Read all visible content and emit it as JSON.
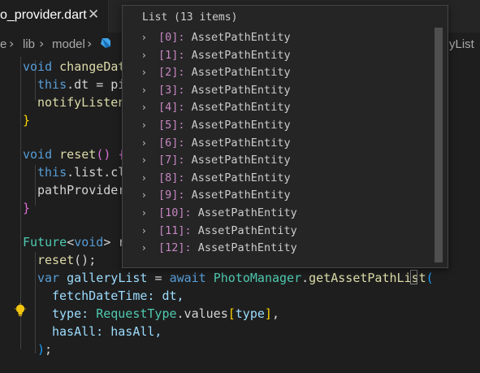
{
  "tab": {
    "title": "o_provider.dart",
    "close": "✕"
  },
  "breadcrumb": {
    "items": [
      "e",
      "lib",
      "model"
    ],
    "separator": "›",
    "trailing": "yList"
  },
  "code": {
    "l1": {
      "kw": "void",
      "fn": "changeDat"
    },
    "l2": {
      "kw": "this",
      "rest": ".dt = pi"
    },
    "l3": {
      "fn": "notifyListen"
    },
    "l4": {
      "brace": "}"
    },
    "l6": {
      "kw": "void",
      "fn": "reset",
      "tail": "() {"
    },
    "l7": {
      "kw": "this",
      "rest": ".list.cl"
    },
    "l8": {
      "rest": "pathProvider"
    },
    "l9": {
      "brace": "}"
    },
    "l11": {
      "ty": "Future",
      "lt": "<",
      "kw": "void",
      "gt": ">",
      "rest": " r"
    },
    "l12": {
      "fn": "reset",
      "tail": "();"
    },
    "l13": {
      "kw": "var",
      "vr": "galleryList",
      "eq": " = ",
      "kw2": "await",
      "ty": "PhotoManager",
      "dot": ".",
      "fn": "getAssetPathList",
      "paren": "("
    },
    "l14": {
      "text": "fetchDateTime: dt,"
    },
    "l15": {
      "label": "type: ",
      "ty": "RequestType",
      "dot": ".values",
      "lb": "[",
      "vr": "type",
      "rb": "]",
      "comma": ","
    },
    "l16": {
      "text": "hasAll: hasAll,"
    },
    "l17": {
      "paren": ")",
      "semi": ";"
    }
  },
  "hover": {
    "title": "List (13 items)",
    "chevron": "›",
    "items": [
      {
        "index": "[0]:",
        "value": "AssetPathEntity"
      },
      {
        "index": "[1]:",
        "value": "AssetPathEntity"
      },
      {
        "index": "[2]:",
        "value": "AssetPathEntity"
      },
      {
        "index": "[3]:",
        "value": "AssetPathEntity"
      },
      {
        "index": "[4]:",
        "value": "AssetPathEntity"
      },
      {
        "index": "[5]:",
        "value": "AssetPathEntity"
      },
      {
        "index": "[6]:",
        "value": "AssetPathEntity"
      },
      {
        "index": "[7]:",
        "value": "AssetPathEntity"
      },
      {
        "index": "[8]:",
        "value": "AssetPathEntity"
      },
      {
        "index": "[9]:",
        "value": "AssetPathEntity"
      },
      {
        "index": "[10]:",
        "value": "AssetPathEntity"
      },
      {
        "index": "[11]:",
        "value": "AssetPathEntity"
      },
      {
        "index": "[12]:",
        "value": "AssetPathEntity"
      }
    ]
  },
  "colors": {
    "background": "#1e1e1e",
    "keyword": "#569cd6",
    "function": "#dcdcaa",
    "type": "#4ec9b0",
    "variable": "#9cdcfe",
    "index": "#c586c0",
    "lightbulb": "#f1c40f"
  },
  "icons": {
    "tab_close": "close-icon",
    "dart_file": "dart-icon",
    "lightbulb": "lightbulb-icon",
    "expand": "chevron-right-icon"
  }
}
